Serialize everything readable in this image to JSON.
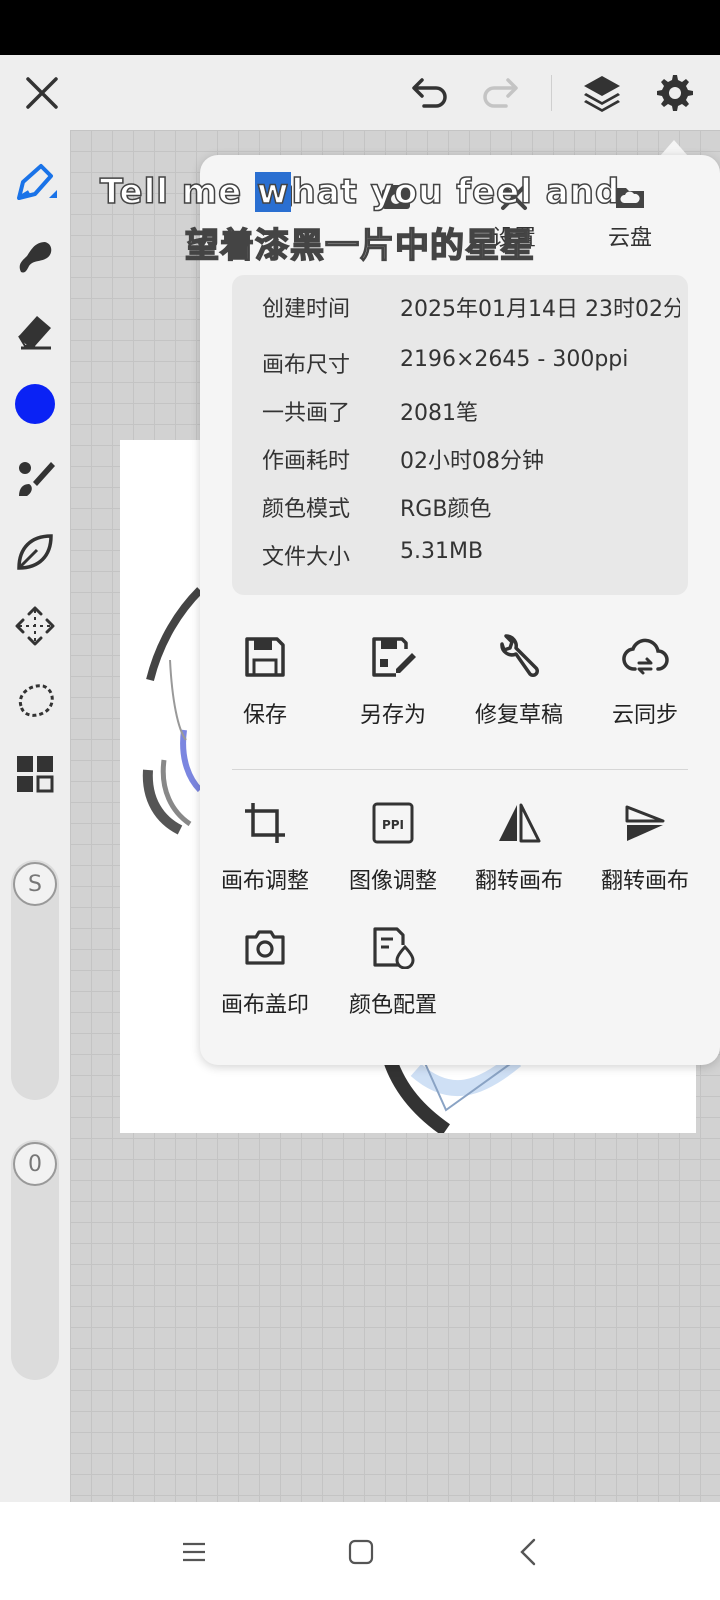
{
  "topbar": {
    "close_icon": "close-icon",
    "undo_icon": "undo-icon",
    "redo_icon": "redo-icon",
    "layers_icon": "layers-icon",
    "settings_icon": "gear-icon"
  },
  "sidebar": {
    "tools": [
      "brush-pen-icon",
      "smudge-icon",
      "eraser-icon",
      "color-swatch",
      "paintbrush-icon",
      "leaf-icon",
      "move-icon",
      "lasso-icon",
      "grid-icon"
    ],
    "current_color": "#0a22f5",
    "size_slider_label": "S",
    "opacity_slider_label": "0"
  },
  "subtitle": {
    "line1_a": "Tell me ",
    "line1_hl": "w",
    "line1_b": "hat you feel and",
    "line2": "望着漆黑一片中的星星"
  },
  "popup": {
    "tabs": [
      {
        "label": "",
        "icon": "canvas-icon"
      },
      {
        "label": "",
        "icon": "camera-icon"
      },
      {
        "label": "设置",
        "icon": "tools-icon"
      },
      {
        "label": "云盘",
        "icon": "cloud-drive-icon"
      }
    ],
    "info": [
      {
        "key": "创建时间",
        "value": "2025年01月14日 23时02分"
      },
      {
        "key": "画布尺寸",
        "value": "2196×2645 - 300ppi"
      },
      {
        "key": "一共画了",
        "value": "2081笔"
      },
      {
        "key": "作画耗时",
        "value": "02小时08分钟"
      },
      {
        "key": "颜色模式",
        "value": "RGB颜色"
      },
      {
        "key": "文件大小",
        "value": "5.31MB"
      }
    ],
    "actions_row1": [
      {
        "label": "保存",
        "icon": "save-icon"
      },
      {
        "label": "另存为",
        "icon": "save-as-icon"
      },
      {
        "label": "修复草稿",
        "icon": "wrench-icon"
      },
      {
        "label": "云同步",
        "icon": "cloud-sync-icon"
      }
    ],
    "actions_row2": [
      {
        "label": "画布调整",
        "icon": "crop-icon"
      },
      {
        "label": "图像调整",
        "icon": "ppi-icon"
      },
      {
        "label": "翻转画布",
        "icon": "flip-horizontal-icon"
      },
      {
        "label": "翻转画布",
        "icon": "flip-vertical-icon"
      }
    ],
    "actions_row3": [
      {
        "label": "画布盖印",
        "icon": "stamp-camera-icon"
      },
      {
        "label": "颜色配置",
        "icon": "color-config-icon"
      }
    ]
  },
  "bottomnav": {
    "menu_icon": "menu-icon",
    "home_icon": "home-icon",
    "back_icon": "back-icon"
  }
}
